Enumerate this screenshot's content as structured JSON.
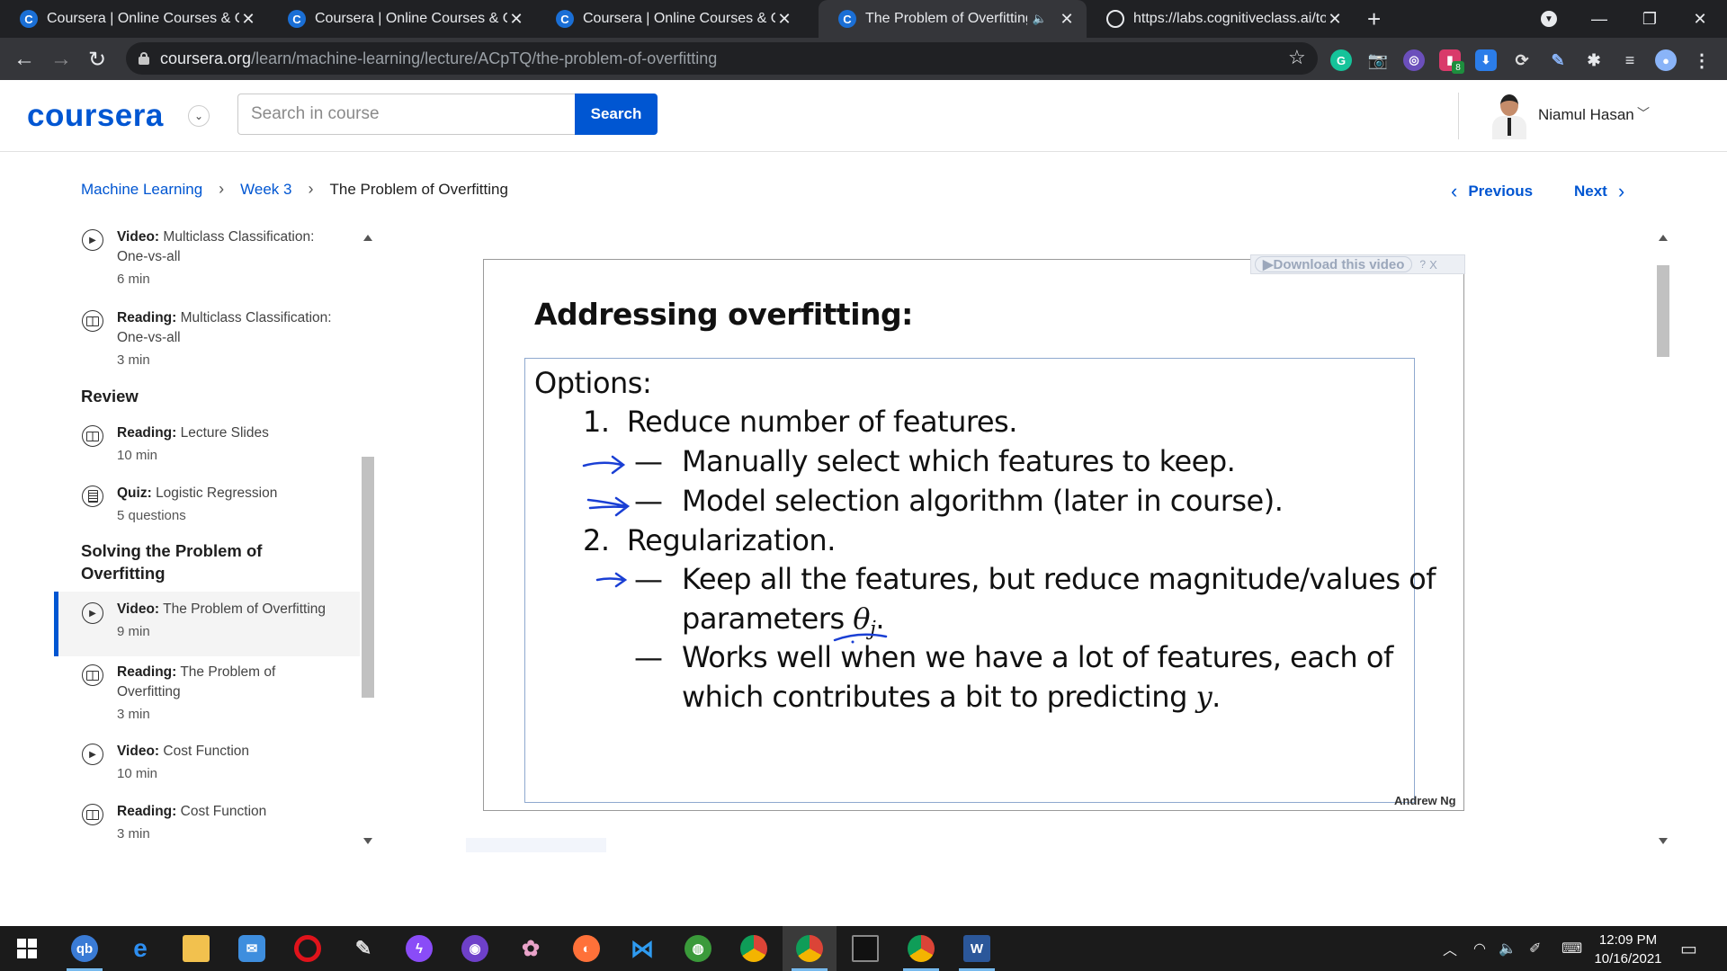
{
  "browser": {
    "tabs": [
      {
        "title": "Coursera | Online Courses & Credentials",
        "favicon": "coursera-icon"
      },
      {
        "title": "Coursera | Online Courses & Credentials",
        "favicon": "coursera-icon"
      },
      {
        "title": "Coursera | Online Courses & Credentials",
        "favicon": "coursera-icon"
      },
      {
        "title": "The Problem of Overfitting | Coursera",
        "favicon": "coursera-icon",
        "audio": "speaker-icon",
        "active": true
      },
      {
        "title": "https://labs.cognitiveclass.ai/tools",
        "favicon": "globe-icon"
      }
    ],
    "url_host": "coursera.org",
    "url_path": "/learn/machine-learning/lecture/ACpTQ/the-problem-of-overfitting",
    "extension_badge": "8"
  },
  "header": {
    "logo": "coursera",
    "search_placeholder": "Search in course",
    "search_button": "Search",
    "user_name": "Niamul Hasan"
  },
  "breadcrumb": {
    "course": "Machine Learning",
    "week": "Week 3",
    "current": "The Problem of Overfitting"
  },
  "nav": {
    "previous": "Previous",
    "next": "Next"
  },
  "sidebar": {
    "items": [
      {
        "type": "Video:",
        "title": "Multiclass Classification: One-vs-all",
        "duration": "6 min",
        "icon": "play-icon"
      },
      {
        "type": "Reading:",
        "title": "Multiclass Classification: One-vs-all",
        "duration": "3 min",
        "icon": "book-icon"
      },
      {
        "type": "Reading:",
        "title": "Lecture Slides",
        "duration": "10 min",
        "icon": "book-icon"
      },
      {
        "type": "Quiz:",
        "title": "Logistic Regression",
        "duration": "5 questions",
        "icon": "quiz-icon"
      },
      {
        "type": "Video:",
        "title": "The Problem of Overfitting",
        "duration": "9 min",
        "icon": "play-icon",
        "active": true
      },
      {
        "type": "Reading:",
        "title": "The Problem of Overfitting",
        "duration": "3 min",
        "icon": "book-icon"
      },
      {
        "type": "Video:",
        "title": "Cost Function",
        "duration": "10 min",
        "icon": "play-icon"
      },
      {
        "type": "Reading:",
        "title": "Cost Function",
        "duration": "3 min",
        "icon": "book-icon"
      }
    ],
    "section_review": "Review",
    "section_solving": "Solving the Problem of Overfitting"
  },
  "slide": {
    "download": "Download this video",
    "help": "?",
    "close": "X",
    "title": "Addressing overfitting:",
    "options": "Options:",
    "item1": "1.  Reduce number of features.",
    "item1a": "Manually select which features to keep.",
    "item1b": "Model selection algorithm (later in course).",
    "item2": "2.  Regularization.",
    "item2a_line1": "Keep all the features, but reduce magnitude/values of",
    "item2a_line2_text": "parameters ",
    "item2a_theta": "θ",
    "item2a_sub": "j",
    "item2a_period": ".",
    "item2b_line1": "Works well when we have a lot of features, each of",
    "item2b_line2_text": "which contributes a bit to predicting ",
    "item2b_y": "y",
    "item2b_period": ".",
    "dash": "—",
    "author": "Andrew Ng",
    "ink_color": "#1a3fd4"
  },
  "taskbar": {
    "time": "12:09 PM",
    "date": "10/16/2021"
  },
  "colors": {
    "brand": "#0056d2",
    "chrome_dark": "#202124",
    "chrome_toolbar": "#35363a"
  }
}
